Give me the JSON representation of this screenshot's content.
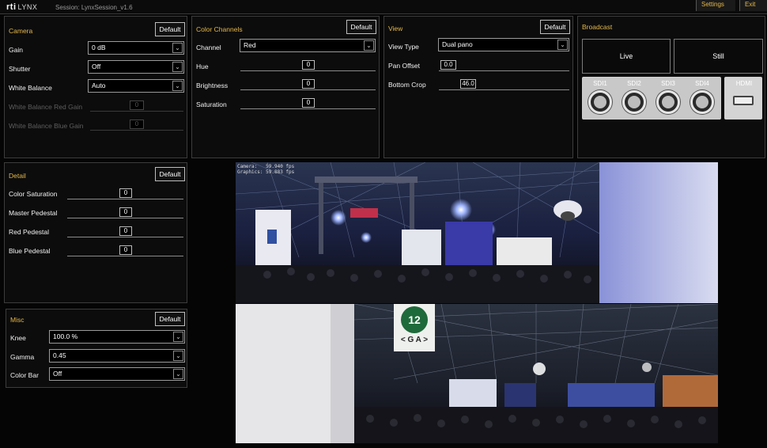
{
  "header": {
    "logo_brand": "rti",
    "logo_product": "LYNX",
    "session": "Session: LynxSession_v1.6",
    "settings_label": "Settings",
    "exit_label": "Exit"
  },
  "camera": {
    "title": "Camera",
    "default_label": "Default",
    "gain_label": "Gain",
    "gain_value": "0 dB",
    "shutter_label": "Shutter",
    "shutter_value": "Off",
    "wb_label": "White Balance",
    "wb_value": "Auto",
    "wb_red_label": "White Balance Red Gain",
    "wb_red_value": "0",
    "wb_blue_label": "White Balance Blue Gain",
    "wb_blue_value": "0"
  },
  "color_channels": {
    "title": "Color Channels",
    "default_label": "Default",
    "channel_label": "Channel",
    "channel_value": "Red",
    "hue_label": "Hue",
    "hue_value": "0",
    "brightness_label": "Brightness",
    "brightness_value": "0",
    "saturation_label": "Saturation",
    "saturation_value": "0"
  },
  "view": {
    "title": "View",
    "default_label": "Default",
    "view_type_label": "View Type",
    "view_type_value": "Dual pano",
    "pan_offset_label": "Pan Offset",
    "pan_offset_value": "0.0",
    "bottom_crop_label": "Bottom Crop",
    "bottom_crop_value": "46.0"
  },
  "broadcast": {
    "title": "Broadcast",
    "live_label": "Live",
    "still_label": "Still",
    "outputs": [
      "SDI1",
      "SDI2",
      "SDI3",
      "SDI4"
    ],
    "hdmi_label": "HDMI"
  },
  "detail": {
    "title": "Detail",
    "default_label": "Default",
    "color_saturation_label": "Color Saturation",
    "color_saturation_value": "0",
    "master_pedestal_label": "Master Pedestal",
    "master_pedestal_value": "0",
    "red_pedestal_label": "Red Pedestal",
    "red_pedestal_value": "0",
    "blue_pedestal_label": "Blue Pedestal",
    "blue_pedestal_value": "0"
  },
  "misc": {
    "title": "Misc",
    "default_label": "Default",
    "knee_label": "Knee",
    "knee_value": "100.0 %",
    "gamma_label": "Gamma",
    "gamma_value": "0.45",
    "color_bar_label": "Color Bar",
    "color_bar_value": "Off"
  },
  "preview": {
    "camera_fps_label": "Camera:",
    "camera_fps_value": "59.940 fps",
    "graphics_fps_label": "Graphics:",
    "graphics_fps_value": "59.883 fps",
    "sign_number": "12",
    "sign_letters": "< G A >"
  },
  "colors": {
    "accent": "#e5b84a",
    "panel_bg": "#0c0c0c",
    "border": "#3c3c3c"
  },
  "icons": {
    "dropdown": "chevron-down-icon",
    "output": "output-connector-icon",
    "hdmi": "hdmi-port-icon"
  }
}
